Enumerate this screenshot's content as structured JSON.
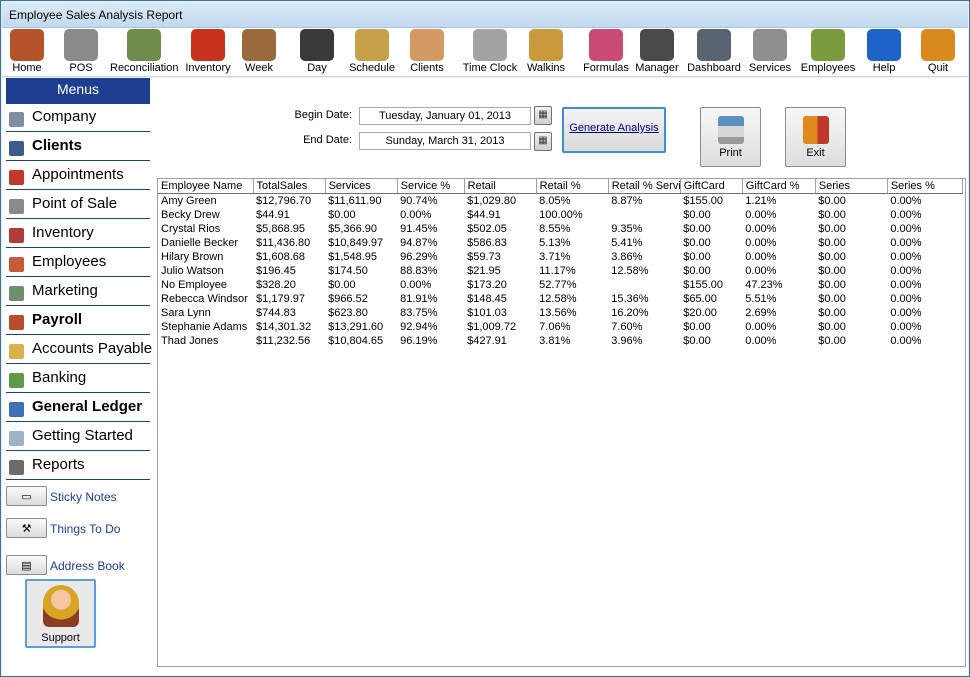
{
  "window": {
    "title": "Employee Sales Analysis Report"
  },
  "toolbar": {
    "items": [
      {
        "label": "Home",
        "icon": "house-icon",
        "color": "#b5532b"
      },
      {
        "label": "POS",
        "icon": "cash-register-icon",
        "color": "#8a8a8a"
      },
      {
        "label": "Reconciliation",
        "icon": "money-stack-icon",
        "color": "#6e8d4d"
      },
      {
        "label": "Inventory",
        "icon": "product-box-icon",
        "color": "#c8311b"
      },
      {
        "label": "Week",
        "icon": "calendar-week-icon",
        "color": "#9a6a3c"
      },
      {
        "label": "Day",
        "icon": "calendar-day-icon",
        "color": "#3a3a3a"
      },
      {
        "label": "Schedule",
        "icon": "schedule-grid-icon",
        "color": "#c6a14a"
      },
      {
        "label": "Clients",
        "icon": "handshake-icon",
        "color": "#d49a64"
      },
      {
        "label": "Time Clock",
        "icon": "stopwatch-icon",
        "color": "#a3a3a3"
      },
      {
        "label": "Walkins",
        "icon": "hourglass-icon",
        "color": "#c89a3b"
      },
      {
        "label": "Formulas",
        "icon": "beaker-icon",
        "color": "#c94b76"
      },
      {
        "label": "Manager",
        "icon": "manager-person-icon",
        "color": "#4a4a4a"
      },
      {
        "label": "Dashboard",
        "icon": "speedometer-icon",
        "color": "#5a6470"
      },
      {
        "label": "Services",
        "icon": "scissors-icon",
        "color": "#8f8f8f"
      },
      {
        "label": "Employees",
        "icon": "people-group-icon",
        "color": "#7a9c3e"
      },
      {
        "label": "Help",
        "icon": "help-question-icon",
        "color": "#1e63c8"
      },
      {
        "label": "Quit",
        "icon": "exit-door-icon",
        "color": "#d98a1e"
      }
    ]
  },
  "sidebar": {
    "header": "Menus",
    "items": [
      {
        "label": "Company",
        "icon": "building-icon",
        "color": "#7f8fa3",
        "bold": false
      },
      {
        "label": "Clients",
        "icon": "clients-icon",
        "color": "#3d5c8a",
        "bold": true
      },
      {
        "label": "Appointments",
        "icon": "calendar-icon",
        "color": "#c0392b",
        "bold": false
      },
      {
        "label": "Point of Sale",
        "icon": "cart-icon",
        "color": "#8a8a8a",
        "bold": false
      },
      {
        "label": "Inventory",
        "icon": "boxes-icon",
        "color": "#b23b3b",
        "bold": false
      },
      {
        "label": "Employees",
        "icon": "employee-icon",
        "color": "#c65a3a",
        "bold": false
      },
      {
        "label": "Marketing",
        "icon": "marketing-icon",
        "color": "#6d8f6d",
        "bold": false
      },
      {
        "label": "Payroll",
        "icon": "payroll-icon",
        "color": "#b84d2e",
        "bold": true
      },
      {
        "label": "Accounts Payable",
        "icon": "payable-icon",
        "color": "#d8b24a",
        "bold": false
      },
      {
        "label": "Banking",
        "icon": "banknote-icon",
        "color": "#5f9a4a",
        "bold": false
      },
      {
        "label": "General Ledger",
        "icon": "ledger-icon",
        "color": "#3f6fb5",
        "bold": true
      },
      {
        "label": "Getting Started",
        "icon": "keyboard-icon",
        "color": "#9fb3c8",
        "bold": false
      },
      {
        "label": "Reports",
        "icon": "report-icon",
        "color": "#6b6b6b",
        "bold": false
      }
    ],
    "utilities": [
      {
        "label": "Sticky Notes",
        "icon": "sticky-note-icon"
      },
      {
        "label": "Things To Do",
        "icon": "hammer-icon"
      },
      {
        "label": "Address Book",
        "icon": "address-book-icon"
      }
    ],
    "support": {
      "label": "Support"
    }
  },
  "filters": {
    "begin_label": "Begin Date:",
    "begin_value": "Tuesday, January 01, 2013",
    "end_label": "End Date:",
    "end_value": "Sunday, March 31, 2013",
    "generate_label": "Generate Analysis",
    "print_label": "Print",
    "exit_label": "Exit"
  },
  "table": {
    "columns": [
      "Employee Name",
      "TotalSales",
      "Services",
      "Service %",
      "Retail",
      "Retail %",
      "Retail % Servi",
      "GiftCard",
      "GiftCard %",
      "Series",
      "Series %"
    ],
    "rows": [
      [
        "Amy Green",
        "$12,796.70",
        "$11,611.90",
        "90.74%",
        "$1,029.80",
        "8.05%",
        "8.87%",
        "$155.00",
        "1.21%",
        "$0.00",
        "0.00%"
      ],
      [
        "Becky Drew",
        "$44.91",
        "$0.00",
        "0.00%",
        "$44.91",
        "100.00%",
        "",
        "$0.00",
        "0.00%",
        "$0.00",
        "0.00%"
      ],
      [
        "Crystal Rios",
        "$5,868.95",
        "$5,366.90",
        "91.45%",
        "$502.05",
        "8.55%",
        "9.35%",
        "$0.00",
        "0.00%",
        "$0.00",
        "0.00%"
      ],
      [
        "Danielle Becker",
        "$11,436.80",
        "$10,849.97",
        "94.87%",
        "$586.83",
        "5.13%",
        "5.41%",
        "$0.00",
        "0.00%",
        "$0.00",
        "0.00%"
      ],
      [
        "Hilary Brown",
        "$1,608.68",
        "$1,548.95",
        "96.29%",
        "$59.73",
        "3.71%",
        "3.86%",
        "$0.00",
        "0.00%",
        "$0.00",
        "0.00%"
      ],
      [
        "Julio Watson",
        "$196.45",
        "$174.50",
        "88.83%",
        "$21.95",
        "11.17%",
        "12.58%",
        "$0.00",
        "0.00%",
        "$0.00",
        "0.00%"
      ],
      [
        "No Employee",
        "$328.20",
        "$0.00",
        "0.00%",
        "$173.20",
        "52.77%",
        "",
        "$155.00",
        "47.23%",
        "$0.00",
        "0.00%"
      ],
      [
        "Rebecca Windsor",
        "$1,179.97",
        "$966.52",
        "81.91%",
        "$148.45",
        "12.58%",
        "15.36%",
        "$65.00",
        "5.51%",
        "$0.00",
        "0.00%"
      ],
      [
        "Sara Lynn",
        "$744.83",
        "$623.80",
        "83.75%",
        "$101.03",
        "13.56%",
        "16.20%",
        "$20.00",
        "2.69%",
        "$0.00",
        "0.00%"
      ],
      [
        "Stephanie Adams",
        "$14,301.32",
        "$13,291.60",
        "92.94%",
        "$1,009.72",
        "7.06%",
        "7.60%",
        "$0.00",
        "0.00%",
        "$0.00",
        "0.00%"
      ],
      [
        "Thad Jones",
        "$11,232.56",
        "$10,804.65",
        "96.19%",
        "$427.91",
        "3.81%",
        "3.96%",
        "$0.00",
        "0.00%",
        "$0.00",
        "0.00%"
      ]
    ]
  }
}
